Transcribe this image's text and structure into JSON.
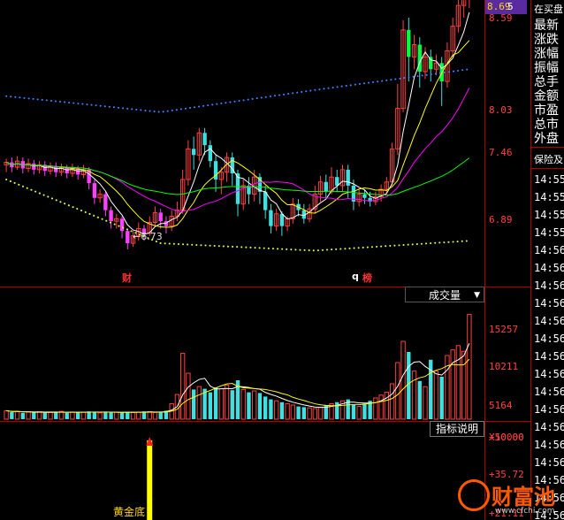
{
  "top_box": {
    "price": "8.69",
    "count": "5"
  },
  "price_axis": [
    "8.59",
    "8.03",
    "7.46",
    "6.89"
  ],
  "low_marker": "6.73",
  "event_marks": [
    {
      "label": "财"
    },
    {
      "label": "q"
    },
    {
      "label": "榜"
    }
  ],
  "volume_panel": {
    "dropdown_label": "成交量",
    "axis": [
      "15257",
      "10211",
      "5164"
    ],
    "unit": "X10000"
  },
  "indicator_panel": {
    "button_label": "指标说明",
    "axis": [
      "+50.00",
      "+35.72",
      "+21.11"
    ],
    "signal_label": "黄金底"
  },
  "side_panel": {
    "items": [
      "在买盘",
      "最新",
      "涨跌",
      "涨幅",
      "振幅",
      "总手",
      "金额",
      "市盈",
      "总市",
      "外盘"
    ],
    "section_label": "保险及",
    "times": [
      "14:55",
      "14:55",
      "14:55",
      "14:55",
      "14:56",
      "14:56",
      "14:56",
      "14:56",
      "14:56",
      "14:56",
      "14:56",
      "14:56",
      "14:56",
      "14:56",
      "14:56",
      "14:56",
      "14:56",
      "14:56",
      "14:56",
      "14:56"
    ]
  },
  "watermark": {
    "name": "财富池",
    "url": "www.cfchi.com"
  },
  "colors": {
    "up": "#ff4040",
    "down": "#40e0e0",
    "grid": "#aa0000",
    "ma5": "#ffffff",
    "ma10": "#ffff00",
    "ma20": "#ff00ff",
    "ma60": "#00ff00"
  },
  "chart_data": {
    "type": "candlestick",
    "ylim": [
      6.6,
      8.75
    ],
    "candles": [
      [
        7.42,
        7.44,
        7.36,
        7.47
      ],
      [
        7.44,
        7.4,
        7.36,
        7.48
      ],
      [
        7.4,
        7.45,
        7.38,
        7.49
      ],
      [
        7.45,
        7.39,
        7.35,
        7.48
      ],
      [
        7.39,
        7.43,
        7.36,
        7.47
      ],
      [
        7.43,
        7.38,
        7.34,
        7.46
      ],
      [
        7.38,
        7.42,
        7.35,
        7.45
      ],
      [
        7.42,
        7.37,
        7.33,
        7.45
      ],
      [
        7.37,
        7.41,
        7.34,
        7.44
      ],
      [
        7.41,
        7.36,
        7.32,
        7.44
      ],
      [
        7.36,
        7.4,
        7.33,
        7.43
      ],
      [
        7.4,
        7.35,
        7.31,
        7.42
      ],
      [
        7.35,
        7.39,
        7.32,
        7.43
      ],
      [
        7.39,
        7.34,
        7.3,
        7.41
      ],
      [
        7.34,
        7.38,
        7.31,
        7.42
      ],
      [
        7.38,
        7.27,
        7.22,
        7.4
      ],
      [
        7.27,
        7.15,
        7.1,
        7.3
      ],
      [
        7.15,
        7.18,
        7.11,
        7.22
      ],
      [
        7.18,
        7.05,
        7.0,
        7.2
      ],
      [
        7.05,
        6.96,
        6.9,
        7.08
      ],
      [
        6.96,
        6.98,
        6.9,
        7.02
      ],
      [
        6.98,
        6.88,
        6.82,
        7.0
      ],
      [
        6.88,
        6.78,
        6.73,
        6.9
      ],
      [
        6.78,
        6.84,
        6.75,
        6.88
      ],
      [
        6.84,
        6.9,
        6.8,
        6.95
      ],
      [
        6.9,
        6.86,
        6.8,
        6.93
      ],
      [
        6.86,
        6.95,
        6.84,
        7.0
      ],
      [
        6.95,
        7.03,
        6.92,
        7.08
      ],
      [
        7.03,
        6.96,
        6.9,
        7.06
      ],
      [
        6.96,
        6.92,
        6.86,
        7.0
      ],
      [
        6.92,
        7.0,
        6.88,
        7.05
      ],
      [
        7.0,
        7.05,
        6.96,
        7.12
      ],
      [
        7.05,
        7.3,
        7.02,
        7.38
      ],
      [
        7.3,
        7.55,
        7.25,
        7.62
      ],
      [
        7.55,
        7.5,
        7.38,
        7.65
      ],
      [
        7.5,
        7.68,
        7.45,
        7.72
      ],
      [
        7.68,
        7.58,
        7.5,
        7.72
      ],
      [
        7.58,
        7.45,
        7.4,
        7.62
      ],
      [
        7.45,
        7.3,
        7.2,
        7.5
      ],
      [
        7.3,
        7.36,
        7.18,
        7.4
      ],
      [
        7.36,
        7.48,
        7.28,
        7.52
      ],
      [
        7.48,
        7.35,
        7.25,
        7.52
      ],
      [
        7.35,
        7.1,
        7.0,
        7.38
      ],
      [
        7.1,
        7.25,
        7.05,
        7.3
      ],
      [
        7.25,
        7.18,
        7.1,
        7.32
      ],
      [
        7.18,
        7.32,
        7.12,
        7.38
      ],
      [
        7.32,
        7.2,
        7.1,
        7.35
      ],
      [
        7.2,
        7.05,
        6.98,
        7.25
      ],
      [
        7.05,
        6.92,
        6.86,
        7.1
      ],
      [
        6.92,
        7.02,
        6.88,
        7.06
      ],
      [
        7.02,
        6.92,
        6.84,
        7.04
      ],
      [
        6.92,
        6.98,
        6.88,
        7.0
      ],
      [
        6.98,
        7.1,
        6.94,
        7.15
      ],
      [
        7.1,
        7.05,
        7.0,
        7.14
      ],
      [
        7.05,
        6.98,
        6.94,
        7.1
      ],
      [
        6.98,
        7.06,
        6.95,
        7.1
      ],
      [
        7.06,
        7.18,
        7.02,
        7.25
      ],
      [
        7.18,
        7.28,
        7.12,
        7.33
      ],
      [
        7.28,
        7.2,
        7.15,
        7.34
      ],
      [
        7.2,
        7.32,
        7.18,
        7.4
      ],
      [
        7.32,
        7.25,
        7.2,
        7.38
      ],
      [
        7.25,
        7.38,
        7.2,
        7.42
      ],
      [
        7.38,
        7.25,
        7.15,
        7.42
      ],
      [
        7.25,
        7.12,
        7.05,
        7.3
      ],
      [
        7.12,
        7.18,
        7.08,
        7.22
      ],
      [
        7.18,
        7.15,
        7.1,
        7.22
      ],
      [
        7.15,
        7.12,
        7.08,
        7.2
      ],
      [
        7.12,
        7.16,
        7.09,
        7.2
      ],
      [
        7.16,
        7.22,
        7.12,
        7.26
      ],
      [
        7.22,
        7.28,
        7.18,
        7.32
      ],
      [
        7.28,
        7.55,
        7.25,
        7.6
      ],
      [
        7.55,
        7.88,
        7.5,
        8.08
      ],
      [
        7.88,
        8.52,
        7.85,
        8.6
      ],
      [
        8.52,
        8.3,
        8.1,
        8.62
      ],
      [
        8.3,
        8.4,
        8.2,
        8.48
      ],
      [
        8.4,
        8.18,
        8.05,
        8.46
      ],
      [
        8.18,
        8.3,
        8.12,
        8.38
      ],
      [
        8.3,
        8.2,
        8.1,
        8.36
      ],
      [
        8.2,
        8.25,
        8.15,
        8.32
      ],
      [
        8.25,
        8.1,
        7.9,
        8.3
      ],
      [
        8.1,
        8.35,
        8.05,
        8.42
      ],
      [
        8.35,
        8.55,
        8.3,
        8.62
      ],
      [
        8.55,
        8.72,
        8.5,
        8.78
      ],
      [
        8.72,
        8.8,
        8.62,
        8.86
      ],
      [
        8.8,
        8.9,
        8.7,
        8.95
      ]
    ],
    "ma_levels": {
      "upper_blue": [
        7.98,
        7.85,
        8.03,
        8.2
      ],
      "lower_yellow": [
        7.3,
        6.78,
        6.72,
        6.8
      ]
    },
    "volume": [
      1200,
      1000,
      1100,
      900,
      1000,
      950,
      1050,
      900,
      980,
      1000,
      1100,
      900,
      1000,
      950,
      1000,
      1100,
      1050,
      900,
      1000,
      950,
      1000,
      900,
      1050,
      950,
      1000,
      1100,
      1050,
      950,
      1000,
      1200,
      2200,
      3500,
      9300,
      6500,
      4200,
      4600,
      4300,
      3800,
      4500,
      4300,
      4800,
      4100,
      5500,
      4200,
      3800,
      4000,
      3700,
      3200,
      2800,
      2600,
      2400,
      2200,
      2000,
      1800,
      1700,
      1600,
      1500,
      1700,
      2000,
      2200,
      2400,
      2600,
      2800,
      2000,
      1800,
      2200,
      2600,
      3000,
      3400,
      3800,
      5000,
      8000,
      11000,
      9500,
      6800,
      5400,
      4600,
      8400,
      6800,
      6000,
      9000,
      9800,
      10400,
      9600,
      14800
    ],
    "indicator": {
      "signal_index": 26
    }
  }
}
